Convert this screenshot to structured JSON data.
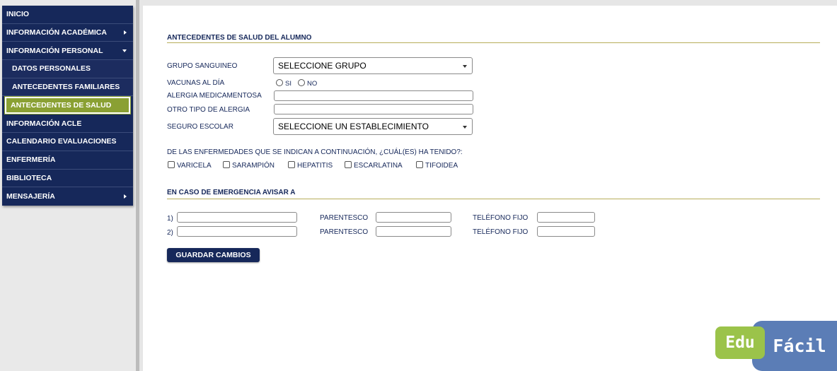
{
  "sidebar": {
    "items": [
      {
        "label": "INICIO"
      },
      {
        "label": "INFORMACIÓN ACADÉMICA"
      },
      {
        "label": "INFORMACIÓN PERSONAL"
      },
      {
        "label": "DATOS PERSONALES"
      },
      {
        "label": "ANTECEDENTES FAMILIARES"
      },
      {
        "label": "ANTECEDENTES DE SALUD"
      },
      {
        "label": "INFORMACIÓN ACLE"
      },
      {
        "label": "CALENDARIO EVALUACIONES"
      },
      {
        "label": "ENFERMERÍA"
      },
      {
        "label": "BIBLIOTECA"
      },
      {
        "label": "MENSAJERÍA"
      }
    ]
  },
  "health": {
    "title": "ANTECEDENTES DE SALUD DEL ALUMNO",
    "blood_group_label": "GRUPO SANGUINEO",
    "blood_group_value": "SELECCIONE GRUPO",
    "vaccines_label": "VACUNAS AL DÍA",
    "vaccines_yes": "SI",
    "vaccines_no": "NO",
    "drug_allergy_label": "ALERGIA MEDICAMENTOSA",
    "other_allergy_label": "OTRO TIPO DE ALERGIA",
    "insurance_label": "SEGURO ESCOLAR",
    "insurance_value": "SELECCIONE UN ESTABLECIMIENTO",
    "diseases_question": "DE LAS ENFERMEDADES QUE SE INDICAN A CONTINUACIÓN, ¿CUÁL(ES) HA TENIDO?:",
    "diseases": [
      "VARICELA",
      "SARAMPIÓN",
      "HEPATITIS",
      "ESCARLATINA",
      "TIFOIDEA"
    ]
  },
  "emergency": {
    "title": "EN CASO DE EMERGENCIA AVISAR A",
    "rows": [
      {
        "index": "1)",
        "relation_label": "PARENTESCO",
        "phone_label": "TELÉFONO FIJO"
      },
      {
        "index": "2)",
        "relation_label": "PARENTESCO",
        "phone_label": "TELÉFONO FIJO"
      }
    ],
    "save_label": "GUARDAR CAMBIOS"
  },
  "logo": {
    "part1": "Edu",
    "part2": "Fácil"
  },
  "colors": {
    "navy": "#16285a",
    "accent_green": "#8aa033",
    "rule": "#b7ad5a",
    "logo_green": "#9bc34a",
    "logo_blue": "#5b7db6"
  }
}
